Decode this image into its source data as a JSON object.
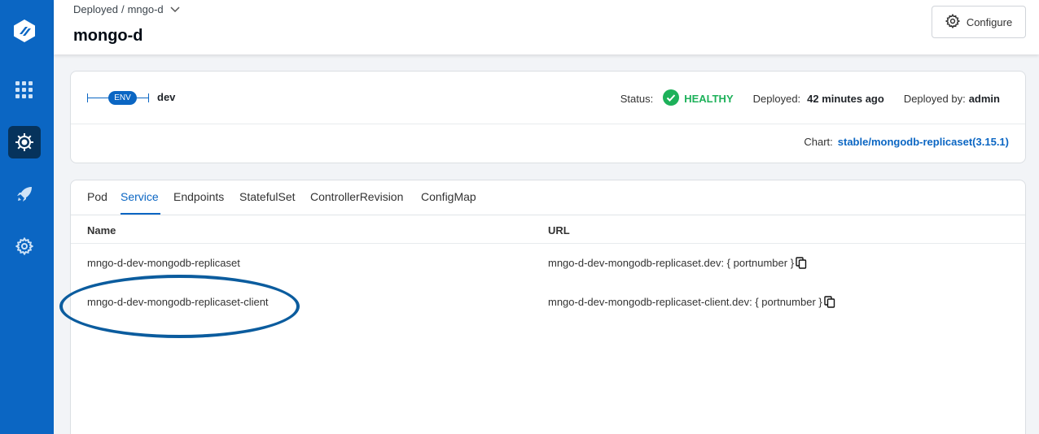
{
  "sidebar": {
    "items": [
      {
        "icon": "app-logo-icon"
      },
      {
        "icon": "apps-grid-icon"
      },
      {
        "icon": "kubernetes-helm-icon",
        "active": true
      },
      {
        "icon": "rocket-icon"
      },
      {
        "icon": "gear-icon"
      }
    ]
  },
  "header": {
    "breadcrumb_parent": "Deployed",
    "breadcrumb_sep": "/",
    "breadcrumb_current": "mngo-d",
    "title": "mongo-d",
    "configure_label": "Configure"
  },
  "env": {
    "badge": "ENV",
    "name": "dev",
    "status_label": "Status:",
    "status_value": "HEALTHY",
    "deployed_label": "Deployed:",
    "deployed_value": "42 minutes ago",
    "deployed_by_label": "Deployed by:",
    "deployed_by_value": "admin",
    "chart_label": "Chart:",
    "chart_value": "stable/mongodb-replicaset(3.15.1)"
  },
  "resources": {
    "tabs": [
      {
        "label": "Pod"
      },
      {
        "label": "Service",
        "active": true
      },
      {
        "label": "Endpoints"
      },
      {
        "label": "StatefulSet"
      },
      {
        "label": "ControllerRevision"
      },
      {
        "label": "ConfigMap"
      }
    ],
    "columns": [
      "Name",
      "URL"
    ],
    "rows": [
      {
        "name": "mngo-d-dev-mongodb-replicaset",
        "url": "mngo-d-dev-mongodb-replicaset.dev: { portnumber }"
      },
      {
        "name": "mngo-d-dev-mongodb-replicaset-client",
        "url": "mngo-d-dev-mongodb-replicaset-client.dev: { portnumber }"
      }
    ]
  },
  "colors": {
    "brand": "#0b66c3",
    "healthy": "#1db15a",
    "annotation": "#0b5c9e"
  }
}
